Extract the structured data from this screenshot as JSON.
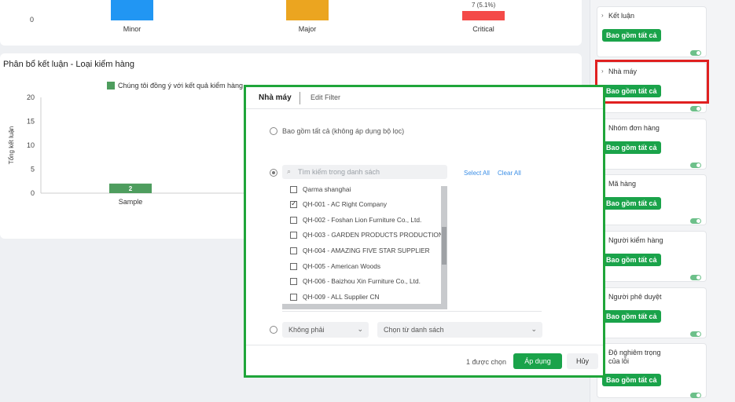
{
  "top_chart": {
    "y_zero": "0",
    "categories": [
      "Minor",
      "Major",
      "Critical"
    ],
    "critical_label": "7 (5.1%)",
    "colors": {
      "minor": "#2196f3",
      "major": "#eba520",
      "critical": "#f44a48"
    }
  },
  "main_chart": {
    "title": "Phân bổ kết luận - Loại kiểm hàng",
    "legend_first": "Chúng tôi đồng ý với kết quả kiểm hàng",
    "chart_data": {
      "type": "bar",
      "categories": [
        "Sample"
      ],
      "series": [
        {
          "name": "Chúng tôi đồng ý với kết quả kiểm hàng",
          "values": [
            2
          ]
        }
      ],
      "ylabel": "Tổng kết luận",
      "ylim": [
        0,
        20
      ],
      "yticks": [
        "20",
        "15",
        "10",
        "5",
        "0"
      ],
      "bar_color": "#4e9d5e"
    }
  },
  "filters": [
    {
      "title": "Kết luận",
      "pill": "Bao gồm tất cả"
    },
    {
      "title": "Nhà máy",
      "pill": "Bao gồm tất cả"
    },
    {
      "title": "Nhóm đơn hàng",
      "pill": "Bao gồm tất cả"
    },
    {
      "title": "Mã hàng",
      "pill": "Bao gồm tất cả"
    },
    {
      "title": "Người kiểm hàng",
      "pill": "Bao gồm tất cả"
    },
    {
      "title": "Người phê duyệt",
      "pill": "Bao gồm tất cả"
    },
    {
      "title": "Độ nghiêm trọng của lỗi",
      "pill": "Bao gồm tất cả"
    }
  ],
  "modal": {
    "tab_active": "Nhà máy",
    "tab_inactive": "Edit Filter",
    "option_all": "Bao gồm tất cả (không áp dụng bộ lọc)",
    "search_placeholder": "Tìm kiếm trong danh sách",
    "select_all": "Select All",
    "clear_all": "Clear All",
    "items": [
      {
        "label": "Qarma shanghai",
        "checked": false
      },
      {
        "label": "QH-001 - AC Right Company",
        "checked": true
      },
      {
        "label": "QH-002 - Foshan Lion Furniture Co., Ltd.",
        "checked": false
      },
      {
        "label": "QH-003 - GARDEN PRODUCTS PRODUCTION",
        "checked": false
      },
      {
        "label": "QH-004 - AMAZING FIVE STAR SUPPLIER",
        "checked": false
      },
      {
        "label": "QH-005 - American Woods",
        "checked": false
      },
      {
        "label": "QH-006 - Baizhou Xin Furniture Co., Ltd.",
        "checked": false
      },
      {
        "label": "QH-009 - ALL Supplier CN",
        "checked": false
      }
    ],
    "dropdown_mode": "Không phải",
    "dropdown_list": "Chọn từ danh sách",
    "selected_count": "1 được chọn",
    "apply": "Áp dụng",
    "cancel": "Hủy"
  }
}
